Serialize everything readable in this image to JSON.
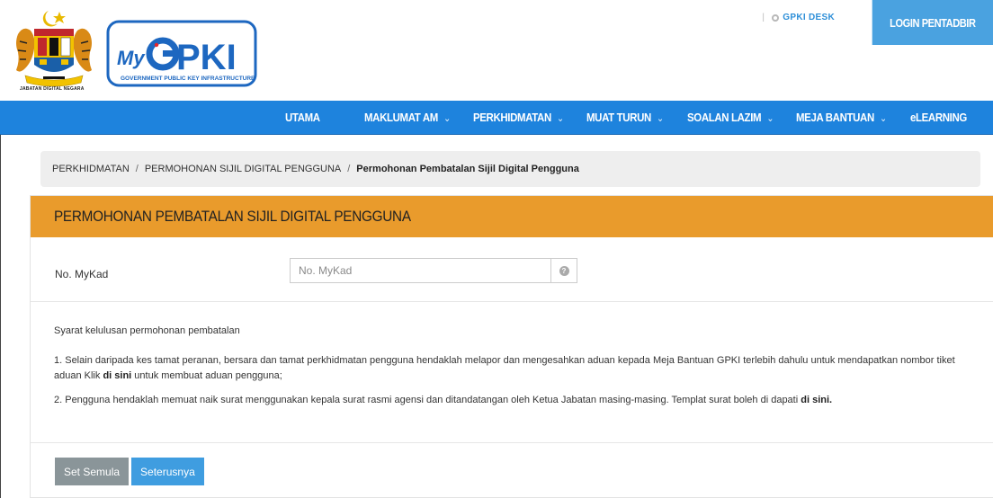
{
  "header": {
    "crest_caption": "JABATAN DIGITAL NEGARA",
    "logo_text": "MyGPKI",
    "logo_tagline": "GOVERNMENT PUBLIC KEY INFRASTRUCTURE",
    "gpki_desk_label": "GPKI DESK",
    "login_label": "LOGIN PENTADBIR"
  },
  "nav": {
    "items": [
      {
        "label": "UTAMA",
        "dropdown": false
      },
      {
        "label": "MAKLUMAT AM",
        "dropdown": true
      },
      {
        "label": "PERKHIDMATAN",
        "dropdown": true
      },
      {
        "label": "MUAT TURUN",
        "dropdown": true
      },
      {
        "label": "SOALAN LAZIM",
        "dropdown": true
      },
      {
        "label": "MEJA BANTUAN",
        "dropdown": true
      },
      {
        "label": "eLEARNING",
        "dropdown": false
      }
    ],
    "chevron": "⌄"
  },
  "breadcrumb": {
    "items": [
      "PERKHIDMATAN",
      "PERMOHONAN SIJIL DIGITAL PENGGUNA"
    ],
    "active": "Permohonan Pembatalan Sijil Digital Pengguna",
    "separator": "/"
  },
  "panel": {
    "heading": "PERMOHONAN PEMBATALAN SIJIL DIGITAL PENGGUNA",
    "mykad_label": "No. MyKad",
    "mykad_placeholder": "No. MyKad",
    "mykad_value": "",
    "help_icon_glyph": "?"
  },
  "terms": {
    "title": "Syarat kelulusan permohonan pembatalan",
    "item1_text": "1. Selain daripada kes tamat peranan, bersara dan tamat perkhidmatan pengguna hendaklah melapor dan mengesahkan aduan kepada Meja Bantuan GPKI terlebih dahulu untuk mendapatkan nombor tiket aduan Klik",
    "item1_link": "di sini",
    "item1_suffix": "untuk membuat aduan pengguna;",
    "item2_text": "2. Pengguna hendaklah memuat naik surat menggunakan kepala surat rasmi agensi dan ditandatangan oleh Ketua Jabatan masing-masing. Templat surat boleh di dapati",
    "item2_link": "di sini."
  },
  "actions": {
    "reset_label": "Set Semula",
    "next_label": "Seterusnya"
  },
  "colors": {
    "nav_blue": "#1e83dd",
    "login_blue": "#4aa2e0",
    "heading_orange": "#e99b2c",
    "reset_grey": "#8a9599",
    "next_blue": "#3f9de0"
  }
}
